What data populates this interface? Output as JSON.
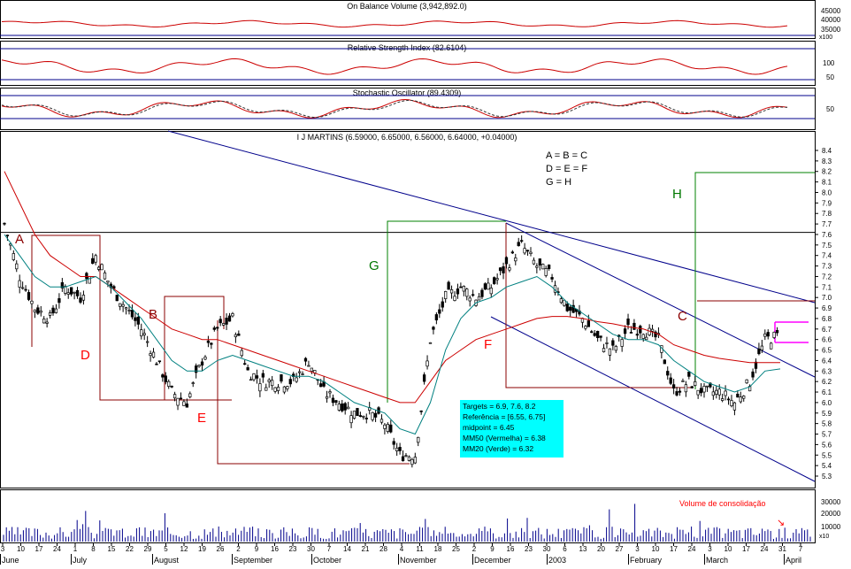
{
  "panels": {
    "obv": {
      "title": "On Balance Volume (3,942,892.0)",
      "ticks": [
        "45000",
        "40000",
        "35000"
      ],
      "scale_note": "x100"
    },
    "rsi": {
      "title": "Relative Strength Index (82.6104)",
      "ticks": [
        "100",
        "50"
      ]
    },
    "stoch": {
      "title": "Stochastic Oscillator (89.4309)",
      "ticks": [
        "50"
      ]
    },
    "volume": {
      "title": "Volume de consolidação",
      "ticks": [
        "30000",
        "20000",
        "10000"
      ],
      "scale_note": "x10"
    }
  },
  "legend_box": {
    "lines": [
      "A = B = C",
      "D = E = F",
      "G = H"
    ]
  },
  "targets_box": {
    "lines": [
      "Targets = 6.9, 7.6, 8.2",
      "Referência = [6.55, 6.75]",
      "midpoint = 6.45",
      "MM50  (Vermelha) = 6.38",
      "MM20 (Verde) = 6.32"
    ],
    "bg_color": "#00ffff"
  },
  "pattern_labels": [
    {
      "text": "A",
      "color": "#8b0000"
    },
    {
      "text": "B",
      "color": "#8b0000"
    },
    {
      "text": "C",
      "color": "#8b0000"
    },
    {
      "text": "D",
      "color": "#ff0000"
    },
    {
      "text": "E",
      "color": "#ff0000"
    },
    {
      "text": "F",
      "color": "#ff0000"
    },
    {
      "text": "G",
      "color": "#007700"
    },
    {
      "text": "H",
      "color": "#007700"
    }
  ],
  "x_axis": {
    "month_labels": [
      "June",
      "July",
      "August",
      "September",
      "October",
      "November",
      "December",
      "2003",
      "February",
      "March",
      "April"
    ],
    "day_labels": [
      "3",
      "10",
      "17",
      "24",
      "1",
      "8",
      "15",
      "22",
      "29",
      "5",
      "12",
      "19",
      "26",
      "2",
      "9",
      "16",
      "23",
      "30",
      "7",
      "14",
      "21",
      "28",
      "4",
      "11",
      "18",
      "25",
      "2",
      "9",
      "16",
      "23",
      "30",
      "6",
      "13",
      "20",
      "27",
      "3",
      "10",
      "17",
      "24",
      "3",
      "10",
      "17",
      "24",
      "31",
      "7"
    ]
  },
  "colors": {
    "price_bar": "#000000",
    "mm50": "#cc0000",
    "mm20": "#008080",
    "trendline": "#00008b",
    "resistance": "#000000",
    "pattern_red": "#8b0000",
    "pattern_green": "#008000",
    "target_magenta": "#ff00ff",
    "indicator_line": "#cc0000",
    "indicator_signal": "#333333",
    "indicator_guide": "#00008b"
  },
  "chart_data": {
    "type": "line",
    "title": "I J MARTINS (6.59000, 6.65000, 6.56000, 6.64000, +0.04000)",
    "ylim": [
      5.2,
      8.5
    ],
    "y_ticks": [
      8.4,
      8.3,
      8.2,
      8.1,
      8.0,
      7.9,
      7.8,
      7.7,
      7.6,
      7.5,
      7.4,
      7.3,
      7.2,
      7.1,
      7.0,
      6.9,
      6.8,
      6.7,
      6.6,
      6.5,
      6.4,
      6.3,
      6.2,
      6.1,
      6.0,
      5.9,
      5.8,
      5.7,
      5.6,
      5.5,
      5.4,
      5.3
    ],
    "resistance_level": 7.62,
    "series": [],
    "price_close_weekly": [
      7.7,
      7.2,
      6.9,
      6.8,
      7.1,
      7.0,
      7.4,
      7.1,
      6.9,
      6.7,
      6.4,
      6.1,
      6.0,
      6.4,
      6.7,
      6.8,
      6.3,
      6.2,
      6.2,
      6.2,
      6.4,
      6.1,
      6.0,
      5.9,
      5.9,
      5.8,
      5.5,
      5.5,
      6.6,
      7.0,
      7.1,
      7.0,
      7.1,
      7.3,
      7.5,
      7.3,
      7.2,
      6.9,
      6.8,
      6.6,
      6.5,
      6.7,
      6.7,
      6.6,
      6.1,
      6.2,
      6.1,
      6.1,
      6.0,
      6.2,
      6.6,
      6.64
    ],
    "mm50_weekly": [
      8.2,
      7.9,
      7.6,
      7.4,
      7.3,
      7.2,
      7.2,
      7.1,
      7.0,
      6.9,
      6.8,
      6.7,
      6.65,
      6.6,
      6.6,
      6.55,
      6.5,
      6.45,
      6.4,
      6.35,
      6.3,
      6.25,
      6.2,
      6.15,
      6.1,
      6.05,
      6.0,
      6.0,
      6.2,
      6.4,
      6.5,
      6.6,
      6.65,
      6.7,
      6.75,
      6.8,
      6.82,
      6.82,
      6.8,
      6.77,
      6.75,
      6.72,
      6.7,
      6.65,
      6.55,
      6.5,
      6.45,
      6.42,
      6.4,
      6.38,
      6.38,
      6.38
    ],
    "mm20_weekly": [
      7.6,
      7.4,
      7.2,
      7.1,
      7.1,
      7.15,
      7.2,
      7.1,
      6.95,
      6.8,
      6.6,
      6.4,
      6.3,
      6.3,
      6.4,
      6.45,
      6.4,
      6.35,
      6.3,
      6.25,
      6.25,
      6.2,
      6.1,
      6.0,
      5.95,
      5.9,
      5.75,
      5.7,
      6.0,
      6.5,
      6.8,
      6.95,
      7.0,
      7.1,
      7.15,
      7.2,
      7.1,
      6.95,
      6.85,
      6.75,
      6.65,
      6.6,
      6.6,
      6.55,
      6.4,
      6.3,
      6.2,
      6.15,
      6.1,
      6.15,
      6.3,
      6.32
    ]
  }
}
